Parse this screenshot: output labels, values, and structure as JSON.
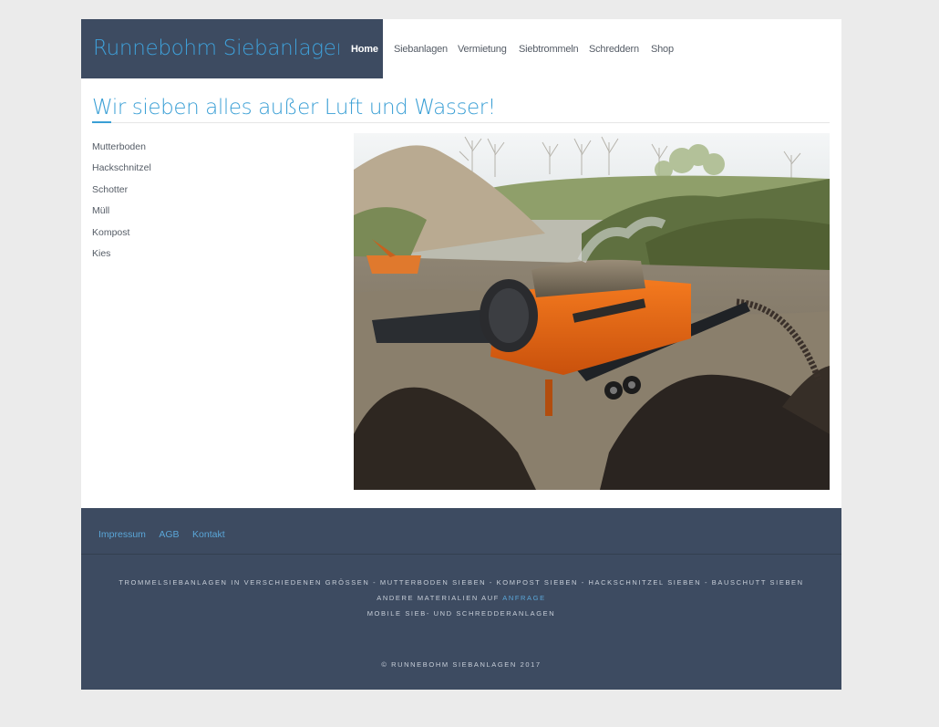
{
  "header": {
    "brand": "Runnebohm Siebanlagen",
    "nav": [
      "Home",
      "Siebanlagen",
      "Vermietung",
      "Siebtrommeln",
      "Schreddern",
      "Shop"
    ]
  },
  "main": {
    "headline": "Wir sieben alles außer Luft und Wasser!",
    "materials": [
      "Mutterboden",
      "Hackschnitzel",
      "Schotter",
      "Müll",
      "Kompost",
      "Kies"
    ]
  },
  "footer": {
    "links": [
      "Impressum",
      "AGB",
      "Kontakt"
    ],
    "line1": "TROMMELSIEBANLAGEN IN VERSCHIEDENEN GRÖSSEN - MUTTERBODEN SIEBEN - KOMPOST SIEBEN - HACKSCHNITZEL SIEBEN - BAUSCHUTT SIEBEN",
    "line2_prefix": "ANDERE MATERIALIEN AUF",
    "line2_link": "ANFRAGE",
    "line3": "MOBILE SIEB- UND SCHREDDERANLAGEN",
    "copyright": "© RUNNEBOHM SIEBANLAGEN 2017"
  },
  "colors": {
    "accent": "#3a9fd5",
    "dark": "#3d4b61",
    "background": "#ebebeb"
  }
}
